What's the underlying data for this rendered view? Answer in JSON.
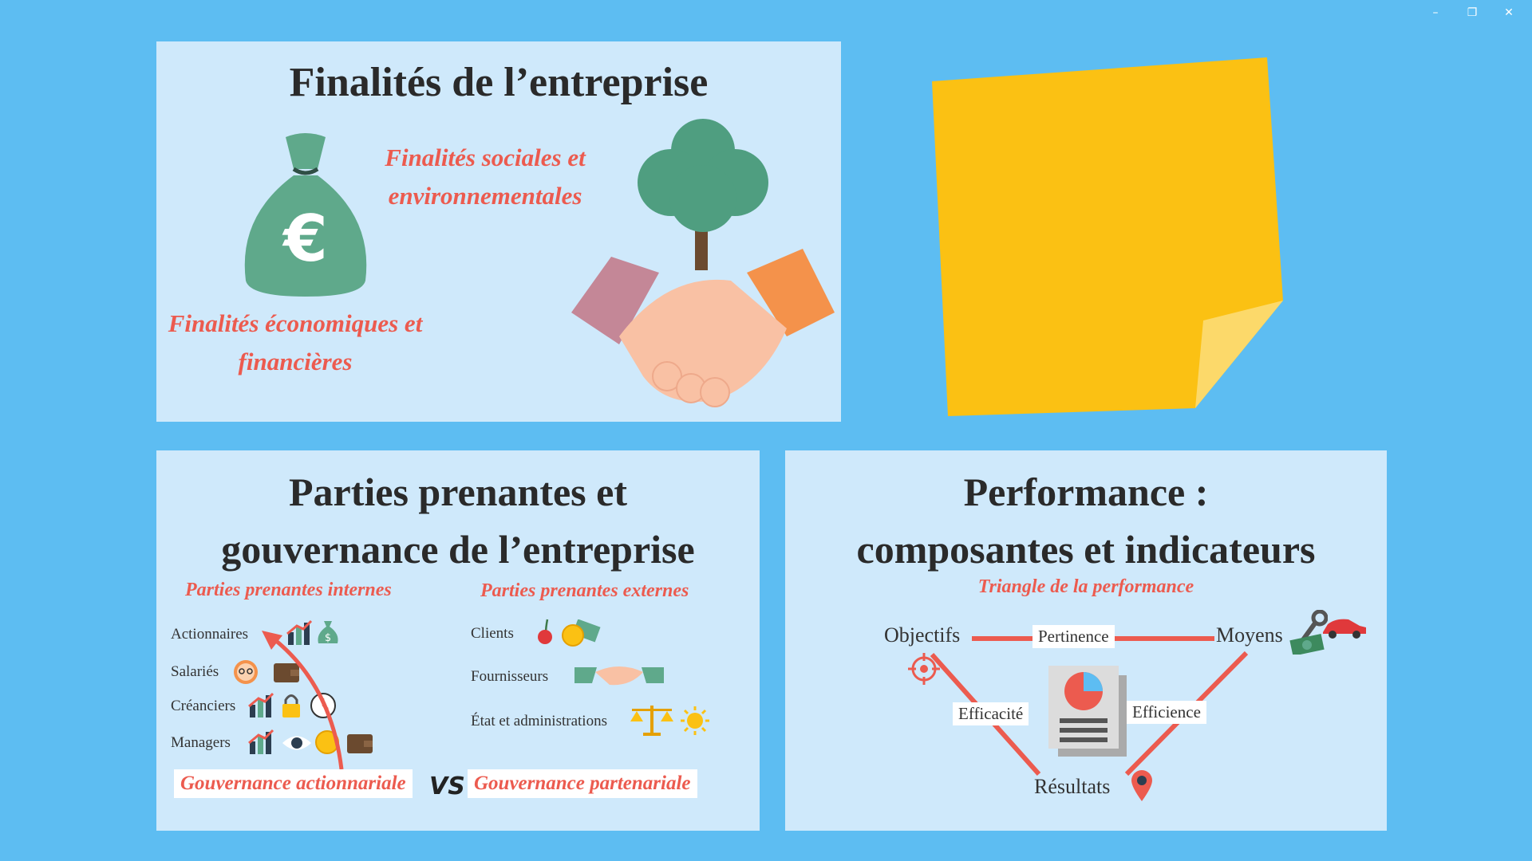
{
  "window": {
    "minimize": "–",
    "restore": "❐",
    "close": "✕"
  },
  "finalites": {
    "title": "Finalités de l’entreprise",
    "sociales_line1": "Finalités sociales et",
    "sociales_line2": "environnementales",
    "economiques_line1": "Finalités économiques et",
    "economiques_line2": "financières",
    "money_symbol": "€"
  },
  "parties": {
    "title_line1": "Parties prenantes et",
    "title_line2": "gouvernance de l’entreprise",
    "internes_label": "Parties prenantes internes",
    "externes_label": "Parties prenantes externes",
    "internes": [
      "Actionnaires",
      "Salariés",
      "Créanciers",
      "Managers"
    ],
    "externes": [
      "Clients",
      "Fournisseurs",
      "État et administrations"
    ],
    "gov_actionnariale": "Gouvernance actionnariale",
    "vs": "VS",
    "gov_partenariale": "Gouvernance partenariale"
  },
  "performance": {
    "title_line1": "Performance :",
    "title_line2": "composantes et indicateurs",
    "subtitle": "Triangle de la performance",
    "objectifs": "Objectifs",
    "moyens": "Moyens",
    "resultats": "Résultats",
    "pertinence": "Pertinence",
    "efficacite": "Efficacité",
    "efficience": "Efficience"
  },
  "colors": {
    "background": "#5dbdf2",
    "panel": "#cfe9fb",
    "accent_red": "#ec5b4f",
    "sticky": "#fbc113",
    "sticky_fold": "#fcd96a",
    "money_bag": "#5fa98b"
  },
  "icons": [
    "money-bag-icon",
    "tree-icon",
    "handshake-icon",
    "chart-icon",
    "dollar-bag-icon",
    "face-icon",
    "wallet-icon",
    "lock-icon",
    "clock-icon",
    "eye-icon",
    "coin-icon",
    "cherry-icon",
    "scales-icon",
    "sun-icon",
    "target-icon",
    "car-icon",
    "wrench-icon",
    "report-icon",
    "map-pin-icon"
  ]
}
